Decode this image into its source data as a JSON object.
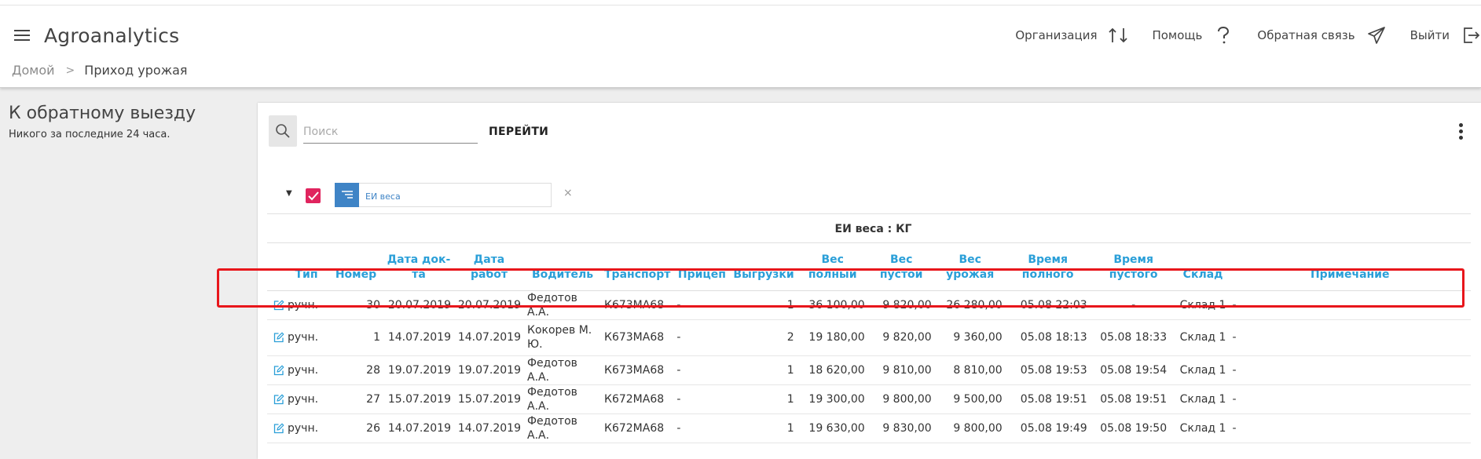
{
  "header": {
    "app_title": "Agroanalytics",
    "nav": [
      {
        "label": "Организация",
        "icon": "swap-arrows-icon"
      },
      {
        "label": "Помощь",
        "icon": "question-icon"
      },
      {
        "label": "Обратная связь",
        "icon": "paper-plane-icon"
      },
      {
        "label": "Выйти",
        "icon": "logout-icon"
      }
    ]
  },
  "breadcrumb": {
    "home": "Домой",
    "separator": ">",
    "current": "Приход урожая"
  },
  "sidebar": {
    "title": "К обратному выезду",
    "subtitle": "Никого за последние 24 часа."
  },
  "toolbar": {
    "search_placeholder": "Поиск",
    "go_label": "ПЕРЕЙТИ"
  },
  "filter": {
    "chip_label": "ЕИ веса",
    "remove": "×"
  },
  "group": {
    "label": "ЕИ веса : КГ"
  },
  "table": {
    "headers": {
      "type": "Тип",
      "number": "Номер",
      "doc_date_1": "Дата док-",
      "doc_date_2": "та",
      "work_date_1": "Дата",
      "work_date_2": "работ",
      "driver": "Водитель",
      "transport": "Транспорт",
      "trailer": "Прицеп",
      "unloads": "Выгрузки",
      "gross_1": "Вес",
      "gross_2": "полный",
      "empty_1": "Вес",
      "empty_2": "пустой",
      "harvest_1": "Вес",
      "harvest_2": "урожая",
      "time_full_1": "Время",
      "time_full_2": "полного",
      "time_empty_1": "Время",
      "time_empty_2": "пустого",
      "warehouse": "Склад",
      "note": "Примечание"
    },
    "rows": [
      {
        "type": "ручн.",
        "number": "30",
        "doc_date": "20.07.2019",
        "work_date": "20.07.2019",
        "driver": "Федотов А.А.",
        "transport": "К673МА68",
        "trailer": "-",
        "unloads": "1",
        "gross": "36 100,00",
        "empty": "9 820,00",
        "harvest": "26 280,00",
        "time_full": "05.08 22:03",
        "time_empty": "-",
        "warehouse": "Склад 1",
        "note": "-"
      },
      {
        "type": "ручн.",
        "number": "1",
        "doc_date": "14.07.2019",
        "work_date": "14.07.2019",
        "driver": "Кокорев М. Ю.",
        "transport": "К673МА68",
        "trailer": "-",
        "unloads": "2",
        "gross": "19 180,00",
        "empty": "9 820,00",
        "harvest": "9 360,00",
        "time_full": "05.08 18:13",
        "time_empty": "05.08 18:33",
        "warehouse": "Склад 1",
        "note": "-"
      },
      {
        "type": "ручн.",
        "number": "28",
        "doc_date": "19.07.2019",
        "work_date": "19.07.2019",
        "driver": "Федотов А.А.",
        "transport": "К673МА68",
        "trailer": "-",
        "unloads": "1",
        "gross": "18 620,00",
        "empty": "9 810,00",
        "harvest": "8 810,00",
        "time_full": "05.08 19:53",
        "time_empty": "05.08 19:54",
        "warehouse": "Склад 1",
        "note": "-"
      },
      {
        "type": "ручн.",
        "number": "27",
        "doc_date": "15.07.2019",
        "work_date": "15.07.2019",
        "driver": "Федотов А.А.",
        "transport": "К672МА68",
        "trailer": "-",
        "unloads": "1",
        "gross": "19 300,00",
        "empty": "9 800,00",
        "harvest": "9 500,00",
        "time_full": "05.08 19:51",
        "time_empty": "05.08 19:51",
        "warehouse": "Склад 1",
        "note": "-"
      },
      {
        "type": "ручн.",
        "number": "26",
        "doc_date": "14.07.2019",
        "work_date": "14.07.2019",
        "driver": "Федотов А.А.",
        "transport": "К672МА68",
        "trailer": "-",
        "unloads": "1",
        "gross": "19 630,00",
        "empty": "9 830,00",
        "harvest": "9 800,00",
        "time_full": "05.08 19:49",
        "time_empty": "05.08 19:50",
        "warehouse": "Склад 1",
        "note": "-"
      }
    ]
  },
  "colors": {
    "accent": "#2a9fd8",
    "checkbox": "#e0245e",
    "chip": "#3f84c6",
    "highlight": "#e8161b"
  }
}
